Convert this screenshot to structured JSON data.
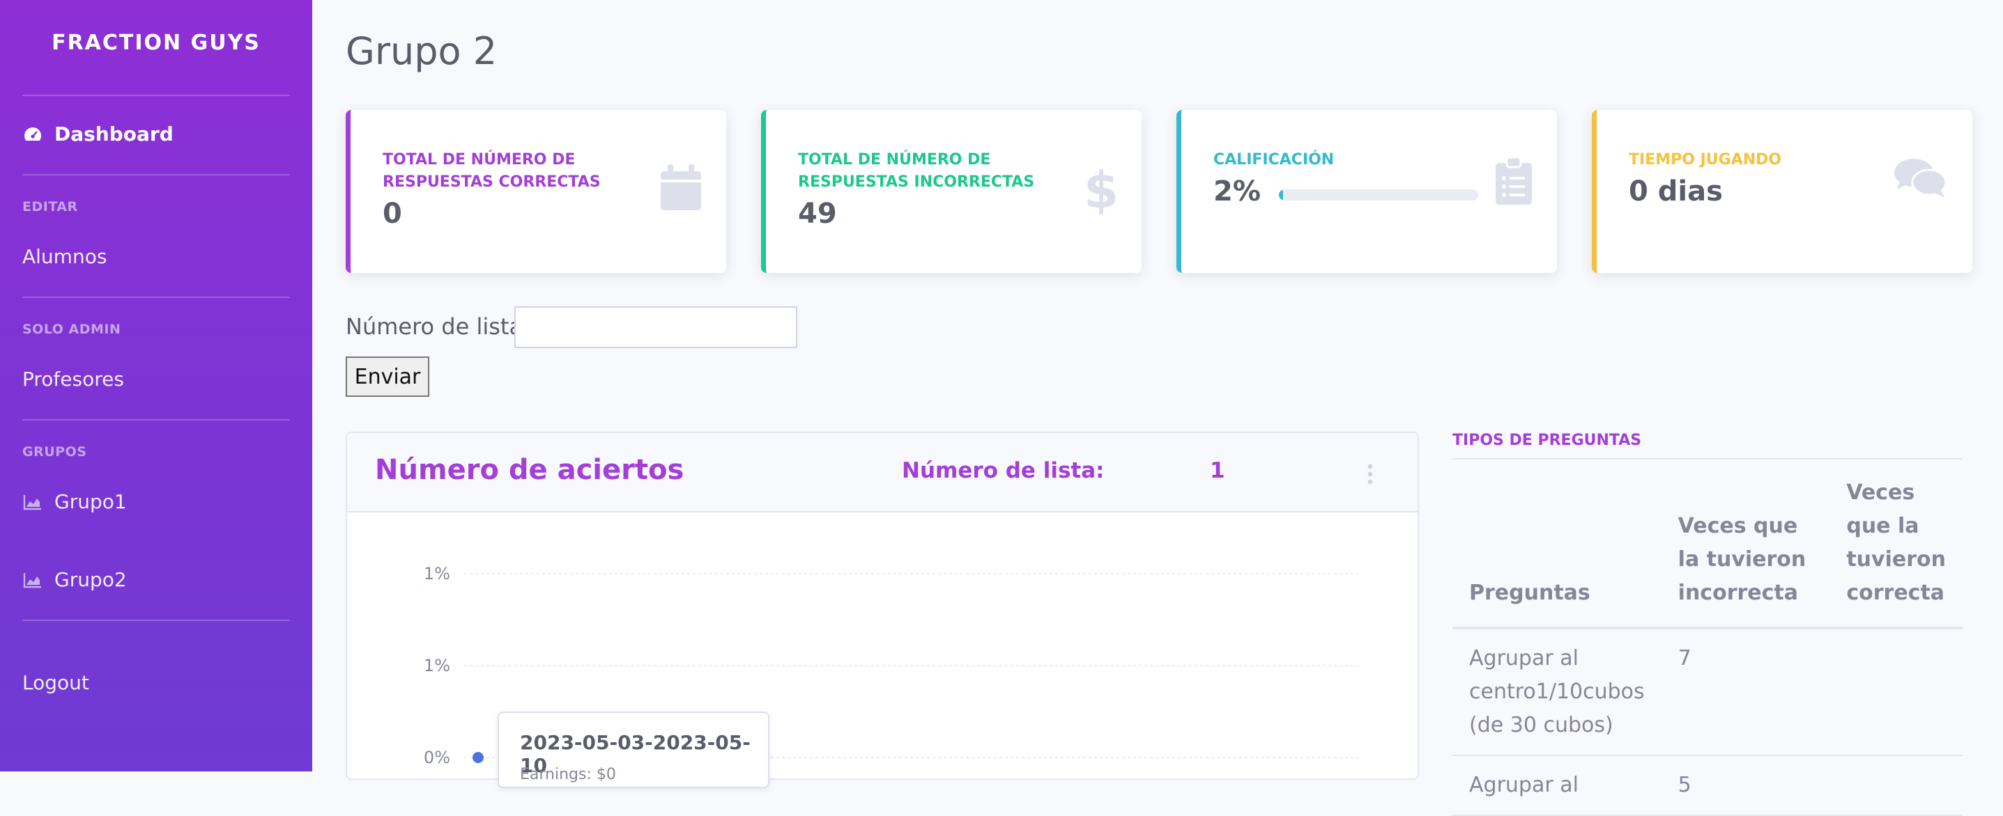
{
  "sidebar": {
    "brand": "FRACTION GUYS",
    "dashboard": "Dashboard",
    "heading_editar": "EDITAR",
    "alumnos": "Alumnos",
    "heading_solo_admin": "SOLO ADMIN",
    "profesores": "Profesores",
    "heading_grupos": "GRUPOS",
    "grupo1": "Grupo1",
    "grupo2": "Grupo2",
    "logout": "Logout"
  },
  "page": {
    "title": "Grupo 2"
  },
  "cards": [
    {
      "label": "TOTAL DE NÚMERO DE RESPUESTAS CORRECTAS",
      "value": "0",
      "color": "#a33fd6",
      "icon": "calendar-icon"
    },
    {
      "label": "TOTAL DE NÚMERO DE RESPUESTAS INCORRECTAS",
      "value": "49",
      "color": "#1cc88a",
      "icon": "dollar-icon"
    },
    {
      "label": "CALIFICACIÓN",
      "value": "2%",
      "progress": 0.02,
      "color": "#36b9cc",
      "icon": "clipboard-list-icon"
    },
    {
      "label": "TIEMPO JUGANDO",
      "value": "0 dias",
      "color": "#f6c23e",
      "icon": "comments-icon"
    }
  ],
  "form": {
    "label": "Número de lista:",
    "input_value": "",
    "button": "Enviar"
  },
  "chart_card": {
    "title": "Número de aciertos",
    "lista_label": "Número de lista:",
    "lista_value": "1",
    "menu_icon": "ellipsis-vertical-icon"
  },
  "chart_data": {
    "type": "line",
    "title": "Número de aciertos",
    "xlabel": "",
    "ylabel": "",
    "y_tick_labels": [
      "1%",
      "1%",
      "0%"
    ],
    "grid": true,
    "series": [
      {
        "x": [
          "2023-05-03-2023-05-10"
        ],
        "values": [
          0
        ],
        "color": "#4e73df"
      }
    ]
  },
  "tooltip": {
    "title": "2023-05-03-2023-05-10",
    "body": "Earnings: $0"
  },
  "table": {
    "heading": "TIPOS DE PREGUNTAS",
    "headers": [
      "Preguntas",
      "Veces que la tuvieron incorrecta",
      "Veces que la tuvieron correcta"
    ],
    "rows": [
      [
        "Agrupar al centro1/10cubos (de 30 cubos)",
        "7",
        ""
      ],
      [
        "Agrupar al",
        "5",
        ""
      ]
    ]
  },
  "colors": {
    "sidebar_top": "#8e2fd6",
    "sidebar_bottom": "#6f3bd2",
    "accent_purple": "#a33fd6",
    "success": "#1cc88a",
    "info": "#36b9cc",
    "warning": "#f6c23e",
    "primary": "#4e73df"
  }
}
